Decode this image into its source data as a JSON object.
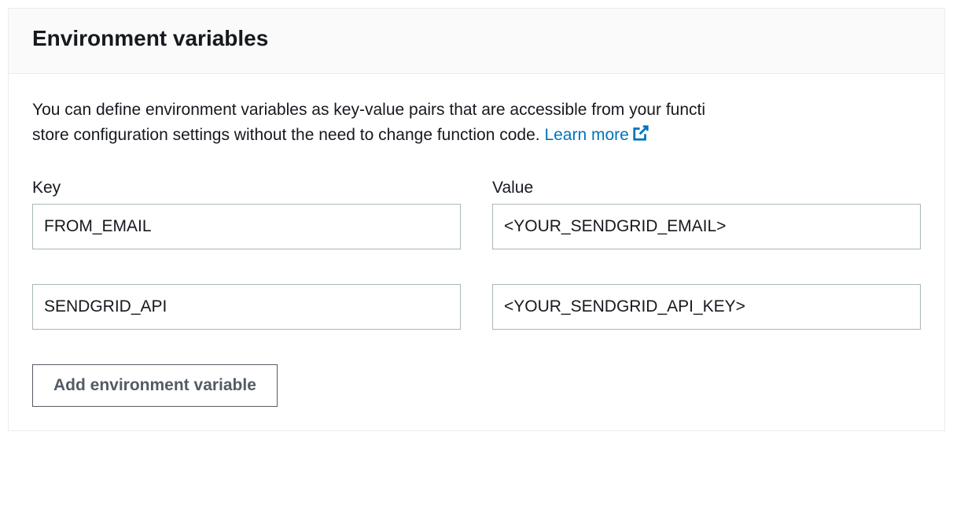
{
  "header": {
    "title": "Environment variables"
  },
  "description": {
    "text_part1": "You can define environment variables as key-value pairs that are accessible from your functi",
    "text_part2": "store configuration settings without the need to change function code. ",
    "learn_more_label": "Learn more"
  },
  "columns": {
    "key_label": "Key",
    "value_label": "Value"
  },
  "rows": [
    {
      "key": "FROM_EMAIL",
      "value": "<YOUR_SENDGRID_EMAIL>"
    },
    {
      "key": "SENDGRID_API",
      "value": "<YOUR_SENDGRID_API_KEY>"
    }
  ],
  "actions": {
    "add_label": "Add environment variable"
  },
  "colors": {
    "link": "#0073bb",
    "border": "#aab7b8",
    "text": "#16191f",
    "muted": "#545b64"
  }
}
